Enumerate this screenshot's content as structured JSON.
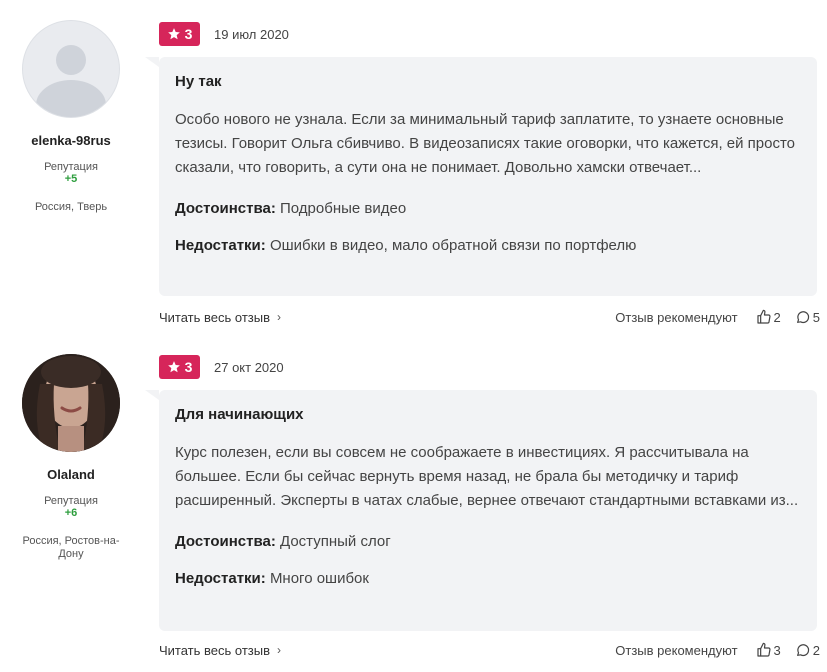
{
  "reviews": [
    {
      "author": {
        "name": "elenka-98rus",
        "reputation_label": "Репутация",
        "reputation": "+5",
        "location": "Россия, Тверь",
        "avatar": "default-avatar"
      },
      "rating": "3",
      "date": "19 июл 2020",
      "title": "Ну так",
      "text": "Особо нового не узнала. Если за минимальный тариф заплатите, то узнаете основные тезисы. Говорит Ольга сбивчиво. В видеозаписях такие оговорки, что кажется, ей просто сказали, что говорить, а сути она не понимает. Довольно хамски отвечает...",
      "pros_label": "Достоинства:",
      "pros": "Подробные видео",
      "cons_label": "Недостатки:",
      "cons": "Ошибки в видео, мало обратной связи по портфелю",
      "read_more": "Читать весь отзыв",
      "recommend_label": "Отзыв рекомендуют",
      "likes": "2",
      "comments": "5"
    },
    {
      "author": {
        "name": "Olaland",
        "reputation_label": "Репутация",
        "reputation": "+6",
        "location": "Россия, Ростов-на-Дону",
        "avatar": "photo-avatar"
      },
      "rating": "3",
      "date": "27 окт 2020",
      "title": "Для начинающих",
      "text": "Курс полезен, если вы совсем не соображаете в инвестициях. Я рассчитывала на большее. Если бы сейчас вернуть время назад, не брала бы методичку и тариф расширенный. Эксперты в чатах слабые, вернее отвечают стандартными вставками из...",
      "pros_label": "Достоинства:",
      "pros": "Доступный слог",
      "cons_label": "Недостатки:",
      "cons": "Много ошибок",
      "read_more": "Читать весь отзыв",
      "recommend_label": "Отзыв рекомендуют",
      "likes": "3",
      "comments": "2"
    }
  ],
  "colors": {
    "badge": "#d6255a",
    "reputation": "#2e9e3e",
    "card": "#f2f3f5"
  },
  "icons": {
    "rating": "star-icon",
    "like": "thumb-up-icon",
    "comment": "comment-icon",
    "more": "chevron-right-icon"
  }
}
